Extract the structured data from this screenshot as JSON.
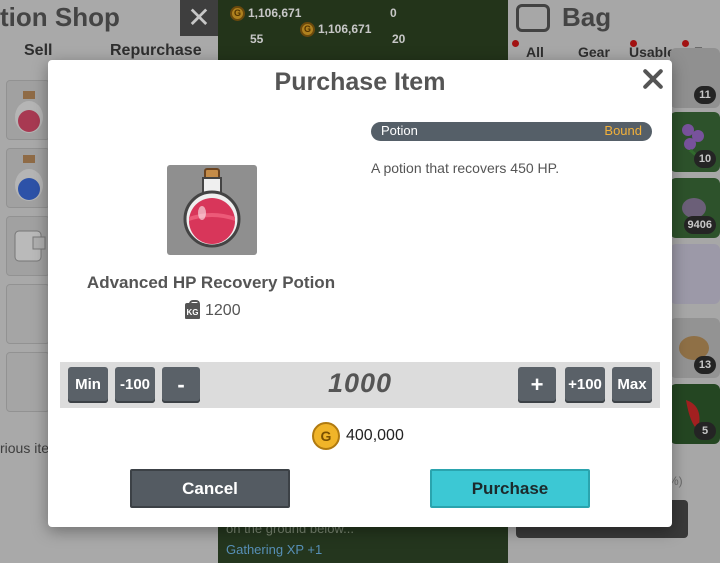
{
  "background": {
    "shop_title": "tion Shop",
    "shop_close": "✕",
    "tabs": [
      "Sell",
      "Repurchase"
    ],
    "hint_text": "rious ite",
    "resources": {
      "gold_left": "1,106,671",
      "gold_center": "1,106,671",
      "count_a": "0",
      "count_b": "55",
      "count_c": "20"
    },
    "log_line1": "on the ground below...",
    "log_line2": "Gathering XP +1",
    "bag_title": "Bag",
    "bag_tabs": [
      "All",
      "Gear",
      "Usable",
      "Foo"
    ],
    "bag_counts": [
      "11",
      "10",
      "9406",
      "13",
      "5"
    ],
    "percent": "%)"
  },
  "dialog": {
    "title": "Purchase Item",
    "item": {
      "name": "Advanced HP Recovery Potion",
      "weight": "1200",
      "weight_icon_text": "KG",
      "type": "Potion",
      "binding": "Bound",
      "description": "A potion that recovers 450 HP."
    },
    "quantity": {
      "min_label": "Min",
      "minus100_label": "-100",
      "minus_label": "-",
      "value": "1000",
      "plus_label": "+",
      "plus100_label": "+100",
      "max_label": "Max"
    },
    "price": "400,000",
    "coin_symbol": "G",
    "cancel_label": "Cancel",
    "purchase_label": "Purchase"
  },
  "colors": {
    "accent": "#3cc8d4",
    "bound": "#f2b13a",
    "dark_button": "#545b62",
    "potion": "#d8365a"
  }
}
